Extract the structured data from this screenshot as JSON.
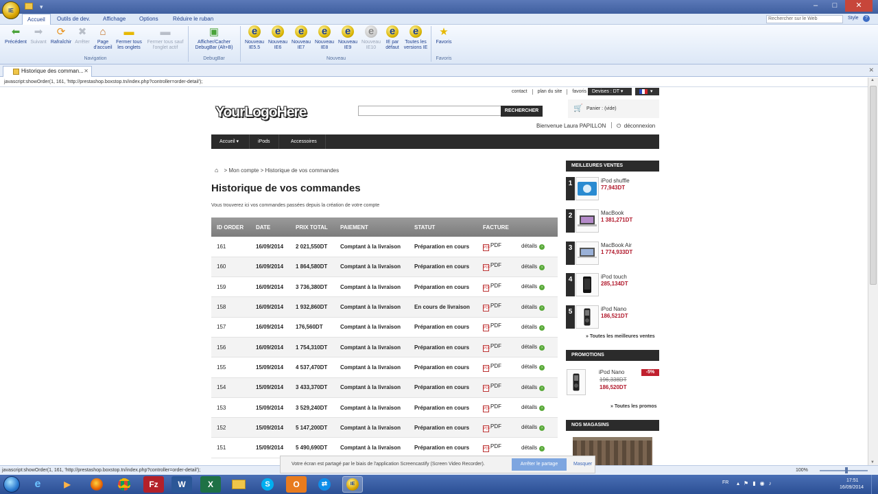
{
  "browser": {
    "orb_label": "IE",
    "menu_tabs": [
      "Accueil",
      "Outils de dev.",
      "Affichage",
      "Options",
      "Réduire le ruban"
    ],
    "search_placeholder": "Rechercher sur le Web",
    "style_label": "Style",
    "help_label": "?",
    "window_controls": [
      "–",
      "□",
      "✕"
    ],
    "ribbon": {
      "navigation": {
        "label": "Navigation",
        "buttons": [
          {
            "label": "Précédent",
            "icon": "back-arrow-icon",
            "disabled": false
          },
          {
            "label": "Suivant",
            "icon": "forward-arrow-icon",
            "disabled": true
          },
          {
            "label": "Rafraîchir",
            "icon": "refresh-icon",
            "disabled": false
          },
          {
            "label": "Arrêter",
            "icon": "stop-icon",
            "disabled": true
          },
          {
            "label": "Page d'accueil",
            "icon": "home-icon",
            "disabled": false
          },
          {
            "label": "Fermer tous les onglets",
            "icon": "folder-icon",
            "disabled": false
          },
          {
            "label": "Fermer tous sauf l'onglet actif",
            "icon": "folder-icon",
            "disabled": true
          }
        ]
      },
      "debugbar": {
        "label": "DebugBar",
        "buttons": [
          {
            "label": "Afficher/Cacher DebugBar (Alt+B)",
            "icon": "debugbar-icon",
            "disabled": false
          }
        ]
      },
      "nouveau": {
        "label": "Nouveau",
        "buttons": [
          {
            "label": "Nouveau IE5.5",
            "disabled": false
          },
          {
            "label": "Nouveau IE6",
            "disabled": false
          },
          {
            "label": "Nouveau IE7",
            "disabled": false
          },
          {
            "label": "Nouveau IE8",
            "disabled": false
          },
          {
            "label": "Nouveau IE9",
            "disabled": false
          },
          {
            "label": "Nouveau IE10",
            "disabled": true
          },
          {
            "label": "IE par défaut",
            "disabled": false
          },
          {
            "label": "Toutes les versions IE",
            "disabled": false
          }
        ]
      },
      "favoris": {
        "label": "Favoris",
        "buttons": [
          {
            "label": "Favoris",
            "icon": "star-icon",
            "disabled": false
          }
        ]
      }
    },
    "tab_title": "Historique des comman...",
    "tab_close": "✕",
    "url_hint": "javascript:showOrder(1, 161, 'http://prestashop.boxstop.tn/index.php?controller=order-detail');",
    "status_url": "javascript:showOrder(1, 161, 'http://prestashop.boxstop.tn/index.php?controller=order-detail');",
    "zoom": "100%"
  },
  "site": {
    "toplinks": [
      "contact",
      "plan du site",
      "favoris"
    ],
    "currency": "Devises : DT",
    "logo": "YourLogoHere",
    "search_button": "RECHERCHER",
    "cart": "Panier : (vide)",
    "welcome": "Bienvenue Laura PAPILLON",
    "logout": "déconnexion",
    "nav": [
      "Accueil",
      "iPods",
      "Accessoires"
    ],
    "breadcrumb": "Mon compte > Historique de vos commandes",
    "title": "Historique de vos commandes",
    "intro": "Vous trouverez ici vos commandes passées depuis la création de votre compte",
    "orders": {
      "columns": [
        "ID ORDER",
        "DATE",
        "PRIX TOTAL",
        "PAIEMENT",
        "STATUT",
        "FACTURE",
        ""
      ],
      "rows": [
        {
          "id": "161",
          "date": "16/09/2014",
          "total": "2 021,550DT",
          "payment": "Comptant à la livraison",
          "status": "Préparation en cours",
          "invoice": "PDF",
          "details": "détails"
        },
        {
          "id": "160",
          "date": "16/09/2014",
          "total": "1 864,580DT",
          "payment": "Comptant à la livraison",
          "status": "Préparation en cours",
          "invoice": "PDF",
          "details": "détails"
        },
        {
          "id": "159",
          "date": "16/09/2014",
          "total": "3 736,380DT",
          "payment": "Comptant à la livraison",
          "status": "Préparation en cours",
          "invoice": "PDF",
          "details": "détails"
        },
        {
          "id": "158",
          "date": "16/09/2014",
          "total": "1 932,860DT",
          "payment": "Comptant à la livraison",
          "status": "En cours de livraison",
          "invoice": "PDF",
          "details": "détails"
        },
        {
          "id": "157",
          "date": "16/09/2014",
          "total": "176,560DT",
          "payment": "Comptant à la livraison",
          "status": "Préparation en cours",
          "invoice": "PDF",
          "details": "détails"
        },
        {
          "id": "156",
          "date": "16/09/2014",
          "total": "1 754,310DT",
          "payment": "Comptant à la livraison",
          "status": "Préparation en cours",
          "invoice": "PDF",
          "details": "détails"
        },
        {
          "id": "155",
          "date": "15/09/2014",
          "total": "4 537,470DT",
          "payment": "Comptant à la livraison",
          "status": "Préparation en cours",
          "invoice": "PDF",
          "details": "détails"
        },
        {
          "id": "154",
          "date": "15/09/2014",
          "total": "3 433,370DT",
          "payment": "Comptant à la livraison",
          "status": "Préparation en cours",
          "invoice": "PDF",
          "details": "détails"
        },
        {
          "id": "153",
          "date": "15/09/2014",
          "total": "3 529,240DT",
          "payment": "Comptant à la livraison",
          "status": "Préparation en cours",
          "invoice": "PDF",
          "details": "détails"
        },
        {
          "id": "152",
          "date": "15/09/2014",
          "total": "5 147,200DT",
          "payment": "Comptant à la livraison",
          "status": "Préparation en cours",
          "invoice": "PDF",
          "details": "détails"
        },
        {
          "id": "151",
          "date": "15/09/2014",
          "total": "5 490,690DT",
          "payment": "Comptant à la livraison",
          "status": "Préparation en cours",
          "invoice": "PDF",
          "details": "détails"
        }
      ]
    },
    "sidebar": {
      "bestsellers_title": "MEILLEURES VENTES",
      "bestsellers": [
        {
          "rank": "1",
          "name": "iPod shuffle",
          "price": "77,943DT"
        },
        {
          "rank": "2",
          "name": "MacBook",
          "price": "1 381,271DT"
        },
        {
          "rank": "3",
          "name": "MacBook Air",
          "price": "1 774,933DT"
        },
        {
          "rank": "4",
          "name": "iPod touch",
          "price": "285,134DT"
        },
        {
          "rank": "5",
          "name": "iPod Nano",
          "price": "186,521DT"
        }
      ],
      "bestsellers_more": "» Toutes les meilleures ventes",
      "promotions_title": "PROMOTIONS",
      "promo": {
        "name": "iPod Nano",
        "old_price": "196,338DT",
        "new_price": "186,520DT",
        "badge": "-5%"
      },
      "promotions_more": "» Toutes les promos",
      "stores_title": "NOS MAGASINS"
    }
  },
  "screencast": {
    "message": "Votre écran est partagé par le biais de l'application Screencastify (Screen Video Recorder).",
    "stop": "Arrêter le partage",
    "hide": "Masquer"
  },
  "taskbar": {
    "apps": [
      "start-orb",
      "internet-explorer",
      "media-player",
      "firefox",
      "chrome",
      "filezilla",
      "word",
      "excel",
      "explorer",
      "skype",
      "outlook",
      "teamviewer",
      "ie-tester"
    ],
    "lang": "FR",
    "time": "17:51",
    "date": "16/09/2014"
  },
  "colors": {
    "accent_red": "#b0172a",
    "nav_dark": "#2b2b2b",
    "ie_blue": "#1d3f8f"
  }
}
